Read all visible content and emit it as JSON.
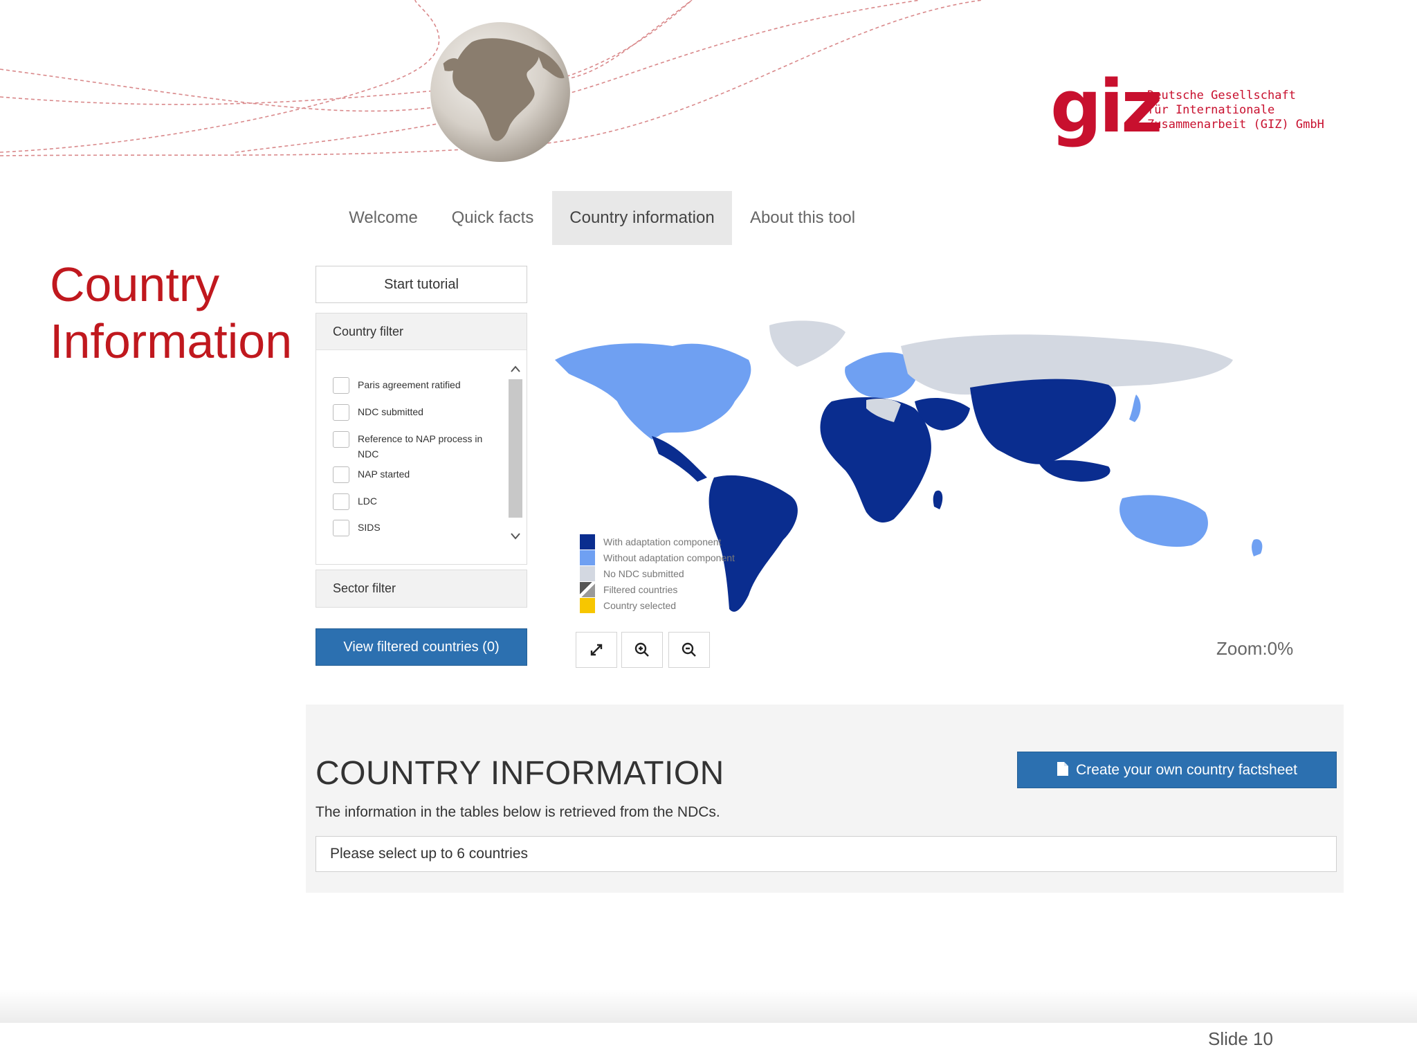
{
  "brand": {
    "logo_word": "giz",
    "logo_text_lines": [
      "Deutsche Gesellschaft",
      "für Internationale",
      "Zusammenarbeit (GIZ) GmbH"
    ],
    "color": "#c8102e"
  },
  "slide": {
    "title_line1": "Country",
    "title_line2": "Information",
    "number": "Slide 10"
  },
  "nav": {
    "tabs": [
      {
        "label": "Welcome",
        "active": false
      },
      {
        "label": "Quick facts",
        "active": false
      },
      {
        "label": "Country information",
        "active": true
      },
      {
        "label": "About this tool",
        "active": false
      }
    ]
  },
  "sidebar": {
    "tutorial_label": "Start tutorial",
    "country_filter": {
      "title": "Country filter",
      "options": [
        {
          "label": "Paris agreement ratified",
          "checked": false
        },
        {
          "label": "NDC submitted",
          "checked": false
        },
        {
          "label": "Reference to NAP process in NDC",
          "checked": false
        },
        {
          "label": "NAP started",
          "checked": false
        },
        {
          "label": "LDC",
          "checked": false
        },
        {
          "label": "SIDS",
          "checked": false
        }
      ]
    },
    "sector_filter_title": "Sector filter",
    "view_filtered_label": "View filtered countries (0)"
  },
  "map": {
    "legend": [
      {
        "label": "With adaptation component",
        "color": "#0a2d8f"
      },
      {
        "label": "Without adaptation component",
        "color": "#6fa0f2"
      },
      {
        "label": "No NDC submitted",
        "color": "#d3d8e1"
      },
      {
        "label": "Filtered countries",
        "color": "striped"
      },
      {
        "label": "Country selected",
        "color": "#f7c600"
      }
    ],
    "controls": [
      {
        "name": "fullscreen-icon"
      },
      {
        "name": "zoom-in-icon"
      },
      {
        "name": "zoom-out-icon"
      }
    ],
    "zoom_text": "Zoom:0%"
  },
  "info": {
    "heading": "COUNTRY INFORMATION",
    "description": "The information in the tables below is retrieved from the NDCs.",
    "factsheet_label": "Create your own country factsheet",
    "select_placeholder": "Please select up to 6 countries"
  },
  "colors": {
    "accent_red": "#c0181e",
    "button_blue": "#2c70b0",
    "with_adaptation": "#0a2d8f",
    "without_adaptation": "#6fa0f2",
    "no_ndc": "#d3d8e1"
  }
}
